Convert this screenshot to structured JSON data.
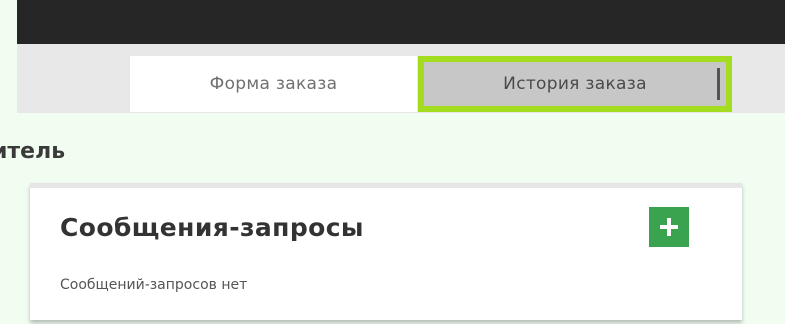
{
  "tabs": [
    {
      "label": "Форма заказа",
      "active": false
    },
    {
      "label": "История заказа",
      "active": true,
      "highlight_color": "#a4dc20"
    }
  ],
  "section": {
    "heading": "итель"
  },
  "messages_panel": {
    "title": "Сообщения-запросы",
    "add_icon": "plus-icon",
    "add_color": "#3aa34f",
    "empty_text": "Сообщений-запросов нет"
  }
}
